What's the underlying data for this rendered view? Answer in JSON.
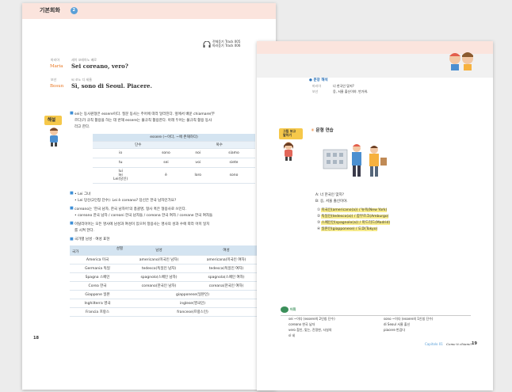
{
  "left": {
    "title": "기본회화",
    "title_num": "2",
    "track": [
      "전체듣기 Track 005",
      "따라듣기 Track 006"
    ],
    "dialogue": [
      {
        "name_ko": "마리아",
        "name": "Maria",
        "gloss": "세이  꼬레아노  베로",
        "sentence": "Sei coreano, vero?"
      },
      {
        "name_ko": "보선",
        "name": "Bosun",
        "gloss": "씨  쏘노  디  세울",
        "sentence": "Sì, sono di Seoul. Piacere."
      }
    ],
    "tag_label": "해설",
    "notes": [
      [
        "sei는 동사원형은 essere이다. 질문 동사는 주어에 따라 달라진다. 앞에서 배운 chiamare(부",
        "르다)가 규칙 활용을 하는 데 반해 essere는 불규칙 활용한다. 아래 두어는 불규칙 활용 동사",
        "라고 한다."
      ]
    ],
    "verb_table": {
      "title": "essere (~이다, ~에 존재하다)",
      "col_groups": [
        "단수",
        "복수"
      ],
      "rows": [
        [
          "io",
          "sono",
          "noi",
          "siamo"
        ],
        [
          "tu",
          "sei",
          "voi",
          "siete"
        ],
        [
          "lui\nlei\nLei(당신)",
          "è",
          "loro",
          "sono"
        ]
      ]
    },
    "note2": [
      "• Lei 그녀",
      "• Lei 당신(2인칭 단수): Lei è coreano? 당신은 한국 남자인가요?"
    ],
    "note3": [
      "coreano는 '한국 남자, 한국 남자어'의 총괄명, 형사 혹은 형용사로 쓰인다.",
      "• coreano 한국 남자 / coreani 한국 남자들 / coreana 한국 여자 / coreane 한국 여자들"
    ],
    "note4": [
      "이탈리아어는 모든 명사에 남성과 여성이 있으며 정용사는 명사의 성과 수에 따라 어미 일치",
      "를 시켜 한다."
    ],
    "note5": "국가별 남성 · 여성 표현",
    "nation_table": {
      "headers": [
        "국가",
        "성별",
        "남성",
        "여성"
      ],
      "rows": [
        [
          "America 미국",
          "americano(미국인 남자)",
          "americana(미국인 여자)"
        ],
        [
          "Germania 독일",
          "tedesco(독일인 남자)",
          "tedesca(독일인 여자)"
        ],
        [
          "Spagna 스페인",
          "spagnolo(스페인 남자)",
          "spagnola(스페인 여자)"
        ],
        [
          "Corea 한국",
          "coreano(한국인 남자)",
          "coreana(한국인 여자)"
        ],
        [
          "Giappone 일본",
          "giapponese(일본인)",
          ""
        ],
        [
          "Inghilterra 영국",
          "inglese(영국인)",
          ""
        ],
        [
          "Francia 프랑스",
          "francese(프랑스인)",
          ""
        ]
      ]
    },
    "page_num": "18"
  },
  "right": {
    "translation_label": "문장 해석",
    "translation": [
      {
        "speaker": "마리아",
        "text": "너 한국인 맞지?"
      },
      {
        "speaker": "보선",
        "text": "응, 서울 출신이야. 반가워."
      }
    ],
    "side_label": [
      "그림 보고",
      "말하기"
    ],
    "practice_title": "문형 연습",
    "qa": [
      "A: 너 한국인 맞지?",
      "B: 응, 서울 출신이야."
    ],
    "options": [
      "미국인(americano(a)) / 뉴욕(New York)",
      "독일인(tedesco(a)) / 함부르크(Amburgo)",
      "스페인인(spagnolo(a)) / 마드리드(Madrid)",
      "일본인(giapponese) / 도쿄(Tokyo)"
    ],
    "vocab_label": "어휘",
    "vocab_left": [
      "sei ~이다 (essere의 2인칭 단수)",
      "coreano 한국 남자",
      "vero 참인, 맞는, 진정한, 사실의",
      "sì 네"
    ],
    "vocab_right": [
      "sono ~이다 (essere의 1인칭 단수)",
      "di Seoul 서울 출신",
      "piacere 반갑다"
    ],
    "footer_chapter": "Capitolo 01",
    "footer_title": "Come ti chiami?",
    "page_num": "19"
  },
  "colors": {
    "accent": "#e8741e",
    "header": "#fbe4dd",
    "table_head": "#d4e4f1",
    "highlight": "#f8ec8c",
    "bullet": "#3f8fd6"
  }
}
